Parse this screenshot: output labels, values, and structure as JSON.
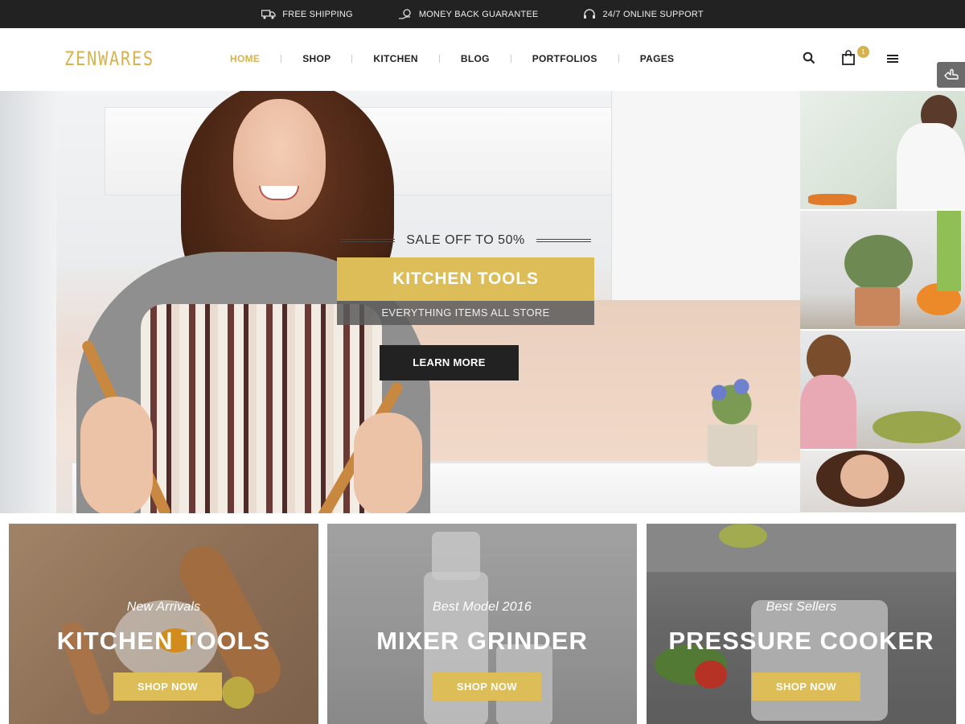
{
  "topbar": {
    "items": [
      {
        "icon": "truck-icon",
        "label": "FREE SHIPPING"
      },
      {
        "icon": "money-hand-icon",
        "label": "MONEY BACK GUARANTEE"
      },
      {
        "icon": "headset-icon",
        "label": "24/7 ONLINE SUPPORT"
      }
    ]
  },
  "header": {
    "logo": "ZENWARES",
    "nav": [
      "HOME",
      "SHOP",
      "KITCHEN",
      "BLOG",
      "PORTFOLIOS",
      "PAGES"
    ],
    "active_nav": "HOME",
    "cart_count": "1",
    "icons": [
      "search-icon",
      "bag-icon",
      "hamburger-menu-icon"
    ]
  },
  "hero": {
    "sale_text": "SALE OFF TO 50%",
    "title": "KITCHEN TOOLS",
    "subtitle": "EVERYTHING ITEMS ALL STORE",
    "cta": "LEARN MORE"
  },
  "categories": [
    {
      "subtitle": "New Arrivals",
      "title": "KITCHEN TOOLS",
      "button": "SHOP NOW"
    },
    {
      "subtitle": "Best Model 2016",
      "title": "MIXER GRINDER",
      "button": "SHOP NOW"
    },
    {
      "subtitle": "Best Sellers",
      "title": "PRESSURE COOKER",
      "button": "SHOP NOW"
    }
  ],
  "colors": {
    "accent": "#dcbd57",
    "logo": "#d6b34f",
    "topbar_bg": "#222222",
    "button_dark": "#222222"
  }
}
